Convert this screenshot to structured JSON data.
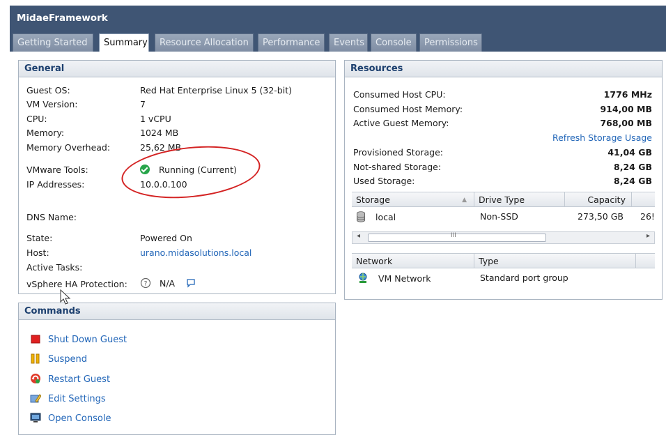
{
  "app": {
    "title": "MidaeFramework"
  },
  "tabs": [
    {
      "label": "Getting Started",
      "active": false
    },
    {
      "label": "Summary",
      "active": true
    },
    {
      "label": "Resource Allocation",
      "active": false
    },
    {
      "label": "Performance",
      "active": false
    },
    {
      "label": "Events",
      "active": false
    },
    {
      "label": "Console",
      "active": false
    },
    {
      "label": "Permissions",
      "active": false
    }
  ],
  "general": {
    "title": "General",
    "guest_os_label": "Guest OS:",
    "guest_os_value": "Red Hat Enterprise Linux 5 (32-bit)",
    "vm_version_label": "VM Version:",
    "vm_version_value": "7",
    "cpu_label": "CPU:",
    "cpu_value": "1 vCPU",
    "memory_label": "Memory:",
    "memory_value": "1024 MB",
    "memory_overhead_label": "Memory Overhead:",
    "memory_overhead_value": "25,62 MB",
    "vmware_tools_label": "VMware Tools:",
    "vmware_tools_value": "Running (Current)",
    "ip_label": "IP Addresses:",
    "ip_value": "10.0.0.100",
    "dns_label": "DNS Name:",
    "state_label": "State:",
    "state_value": "Powered On",
    "host_label": "Host:",
    "host_value": "urano.midasolutions.local",
    "active_tasks_label": "Active Tasks:",
    "ha_label": "vSphere HA Protection:",
    "ha_value": "N/A"
  },
  "commands": {
    "title": "Commands",
    "items": [
      {
        "label": "Shut Down Guest",
        "icon": "stop-icon"
      },
      {
        "label": "Suspend",
        "icon": "pause-icon"
      },
      {
        "label": "Restart Guest",
        "icon": "restart-icon"
      },
      {
        "label": "Edit Settings",
        "icon": "edit-settings-icon"
      },
      {
        "label": "Open Console",
        "icon": "console-icon"
      }
    ]
  },
  "resources": {
    "title": "Resources",
    "consumed_cpu_label": "Consumed Host CPU:",
    "consumed_cpu_value": "1776 MHz",
    "consumed_mem_label": "Consumed Host Memory:",
    "consumed_mem_value": "914,00 MB",
    "active_mem_label": "Active Guest Memory:",
    "active_mem_value": "768,00 MB",
    "refresh_link": "Refresh Storage Usage",
    "provisioned_label": "Provisioned Storage:",
    "provisioned_value": "41,04 GB",
    "not_shared_label": "Not-shared Storage:",
    "not_shared_value": "8,24 GB",
    "used_label": "Used Storage:",
    "used_value": "8,24 GB",
    "storage_table": {
      "headers": [
        "Storage",
        "Drive Type",
        "Capacity"
      ],
      "row": {
        "storage": "local",
        "drive_type": "Non-SSD",
        "capacity": "273,50 GB",
        "extra": "26!"
      }
    },
    "network_table": {
      "headers": [
        "Network",
        "Type"
      ],
      "row": {
        "network": "VM Network",
        "type": "Standard port group"
      }
    },
    "scroll_grip": "III"
  },
  "colors": {
    "header_bg": "#3f5574",
    "link": "#2266b8",
    "annotation": "#d42323"
  }
}
